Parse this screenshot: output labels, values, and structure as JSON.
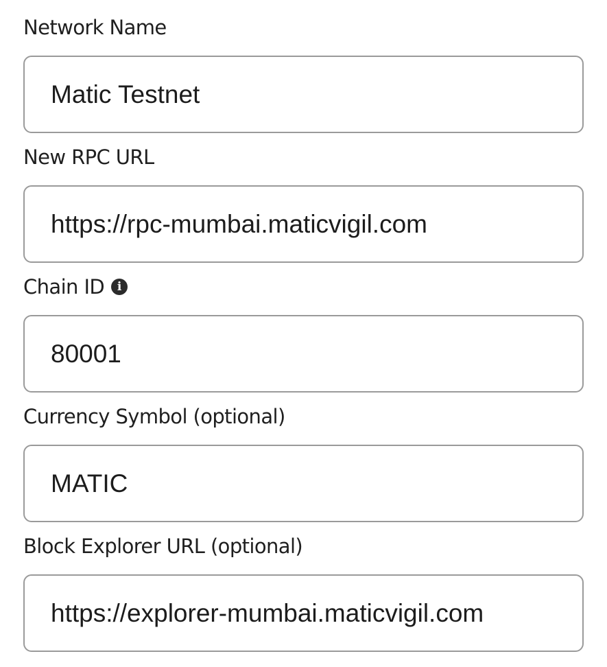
{
  "form": {
    "fields": [
      {
        "label": "Network Name",
        "value": "Matic Testnet"
      },
      {
        "label": "New RPC URL",
        "value": "https://rpc-mumbai.maticvigil.com"
      },
      {
        "label": "Chain ID",
        "value": "80001",
        "info_icon": "info-icon"
      },
      {
        "label": "Currency Symbol (optional)",
        "value": "MATIC"
      },
      {
        "label": "Block Explorer URL (optional)",
        "value": "https://explorer-mumbai.maticvigil.com"
      }
    ]
  }
}
